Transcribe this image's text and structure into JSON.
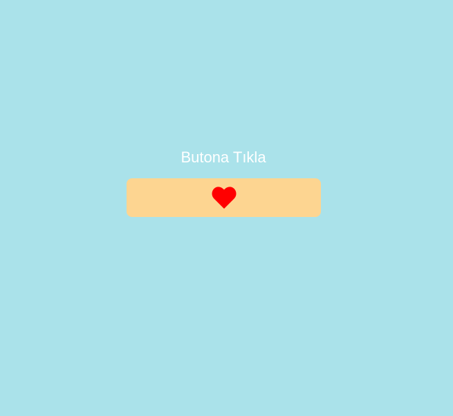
{
  "page": {
    "title": "Butona Tıkla",
    "background_color": "#aae2ea"
  },
  "button": {
    "icon": "heart-icon",
    "background_color": "#fdd591",
    "icon_color": "#ff0000"
  }
}
